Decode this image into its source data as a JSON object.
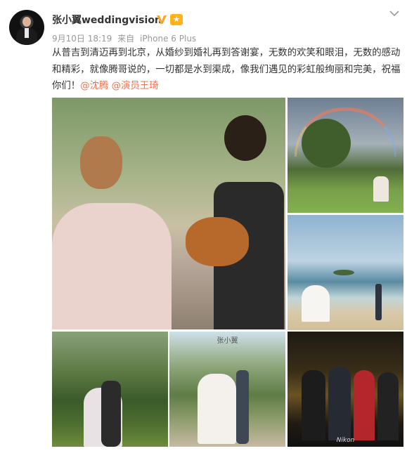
{
  "post": {
    "username": "张小翼weddingvision",
    "date": "9月10日 18:19",
    "source_prefix": "来自",
    "source": "iPhone 6 Plus",
    "text_main": "从普吉到清迈再到北京，从婚纱到婚礼再到答谢宴，无数的欢笑和眼泪，无数的感动和精彩，就像腾哥说的，一切都是水到渠成，像我们遇见的彩虹般绚丽和完美，祝福你们！",
    "mention_1": "@沈腾",
    "mention_2": "@演员王琦"
  },
  "photos": {
    "p5_watermark": "张小翼",
    "p6_brand": "Nikon"
  },
  "icons": {
    "verified": "verified-v-icon",
    "level": "member-badge-icon",
    "menu": "chevron-down-icon"
  },
  "colors": {
    "mention": "#eb7350",
    "verified": "#f5a623",
    "meta": "#999999"
  }
}
